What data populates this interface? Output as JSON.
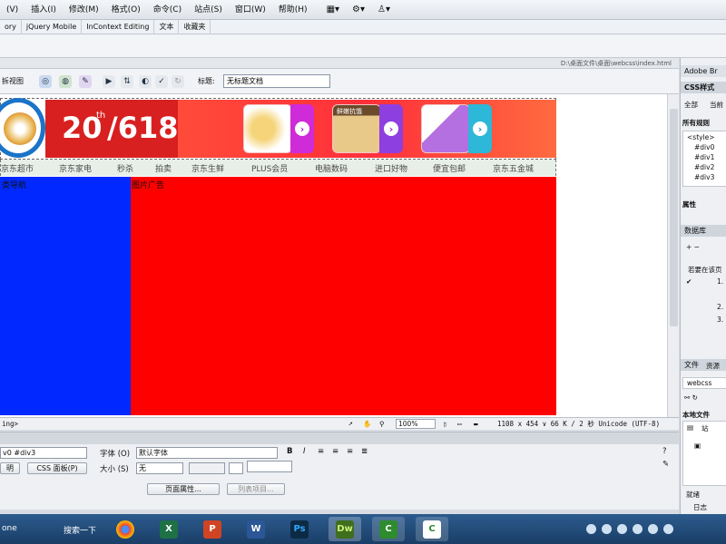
{
  "menu": {
    "items": [
      "(V)",
      "插入(I)",
      "修改(M)",
      "格式(O)",
      "命令(C)",
      "站点(S)",
      "窗口(W)",
      "帮助(H)"
    ]
  },
  "insert_bar": {
    "tabs": [
      "ory",
      "jQuery Mobile",
      "InContext Editing",
      "文本",
      "收藏夹"
    ]
  },
  "document": {
    "path": "D:\\桌面文件\\桌面\\webcss\\index.html",
    "view_label": "拆视图",
    "title_label": "标题:",
    "title_value": "无标题文档"
  },
  "page": {
    "promo_number": "20",
    "promo_sup": "th",
    "promo_suffix": "/618",
    "product_badge": "鲜嫩抗饿",
    "nav_items": [
      "京东超市",
      "京东家电",
      "秒杀",
      "拍卖",
      "京东生鲜",
      "PLUS会员",
      "电脑数码",
      "进口好物",
      "便宜包邮",
      "京东五金城"
    ],
    "blue_label": "类导航",
    "red_label": "图片广告"
  },
  "status": {
    "left_tag": "ing>",
    "zoom": "100%",
    "info": "1108 x 454 ∨  66 K / 2 秒  Unicode (UTF-8)"
  },
  "properties": {
    "selector": "v0 #div3",
    "font_label": "字体 (O)",
    "font_value": "默认字体",
    "size_label": "大小 (S)",
    "size_value": "无",
    "btn_left": "明",
    "btn_css": "CSS 面板(P)",
    "btn_page_props": "页面属性...",
    "btn_list": "列表项目..."
  },
  "right_panel": {
    "app_title": "Adobe Br",
    "css_tab": "CSS样式",
    "all_tab": "全部",
    "current_tab": "当前",
    "rules_heading": "所有规则",
    "rules": [
      "<style>",
      "#div0",
      "#div1",
      "#div2",
      "#div3"
    ],
    "props_heading": "属性",
    "db_tab": "数据库",
    "help_text": "若要在该页",
    "steps": [
      "1.",
      "2.",
      "3."
    ],
    "files_tab": "文件",
    "assets_tab": "资源",
    "site_name": "webcss",
    "local_files": "本地文件",
    "site_label": "站",
    "ready": "就绪",
    "log_btn": "日志"
  },
  "taskbar": {
    "start_label": "one",
    "search_label": "搜索一下",
    "apps": [
      "chrome-icon",
      "excel-icon",
      "powerpoint-icon",
      "word-icon",
      "photoshop-icon",
      "dreamweaver-icon",
      "camtasia-icon",
      "camtasia-recorder-icon"
    ]
  }
}
